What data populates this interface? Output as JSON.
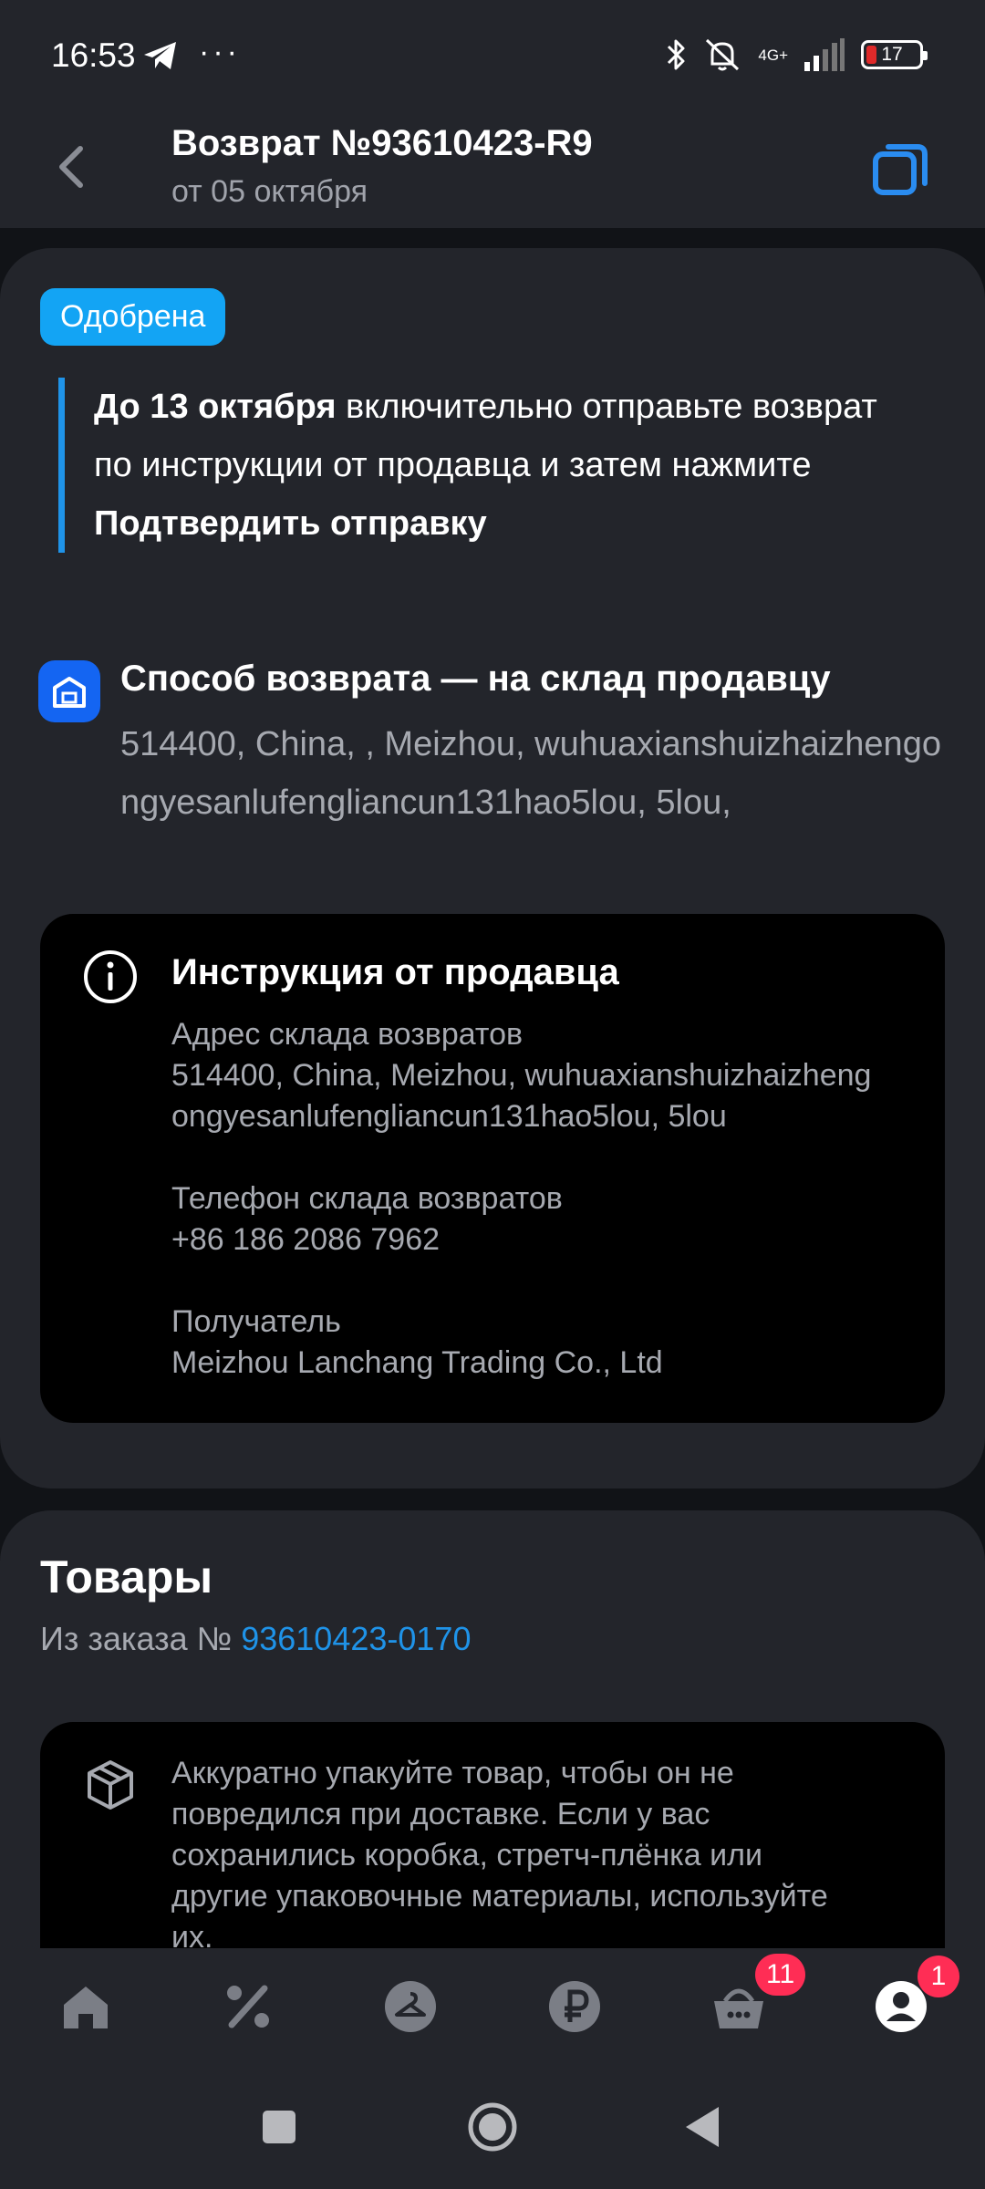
{
  "status_bar": {
    "time": "16:53",
    "dots": "···",
    "network_label": "4G+",
    "battery": "17",
    "icons": [
      "telegram-icon",
      "bluetooth-icon",
      "muted-bell-icon",
      "signal-icon",
      "battery-icon"
    ]
  },
  "header": {
    "title": "Возврат №93610423-R9",
    "subtitle": "от 05 октября"
  },
  "return_card": {
    "status_badge": "Одобрена",
    "notice": {
      "deadline_bold": "До 13 октября",
      "text_part1": " включительно отправьте возврат по инструкции от продавца и затем нажмите ",
      "action_bold": "Подтвердить отправку"
    },
    "method_title": "Способ возврата — на склад продавцу",
    "method_address": "514400,  China,  ,  Meizhou, wuhuaxianshuizhaizhengongyesanlufengliancun131hao5lou,  5lou,",
    "instruction": {
      "title": "Инструкция от продавца",
      "address_label": "Адрес склада возвратов",
      "address_value": "514400, China, Meizhou, wuhuaxianshuizhaizhengongyesanlufengliancun131hao5lou, 5lou",
      "phone_label": "Телефон склада возвратов",
      "phone_value": "+86 186 2086 7962",
      "recipient_label": "Получатель",
      "recipient_value": "Meizhou Lanchang Trading Co., Ltd"
    }
  },
  "goods_card": {
    "title": "Товары",
    "order_prefix": "Из заказа № ",
    "order_number": "93610423-0170",
    "packing_tip": "Аккуратно упакуйте товар, чтобы он не повредился при доставке. Если у вас сохранились коробка, стретч-плёнка или другие упаковочные материалы, используйте их."
  },
  "bottom_nav": {
    "items": [
      "home-icon",
      "discount-icon",
      "catalog-icon",
      "ruble-icon",
      "cart-icon",
      "profile-icon"
    ],
    "cart_badge": "11",
    "profile_badge": "1"
  },
  "colors": {
    "background": "#111317",
    "surface": "#23252b",
    "accent_blue": "#1f93e8",
    "badge_blue": "#13a4f4",
    "badge_red": "#ff2d55"
  }
}
